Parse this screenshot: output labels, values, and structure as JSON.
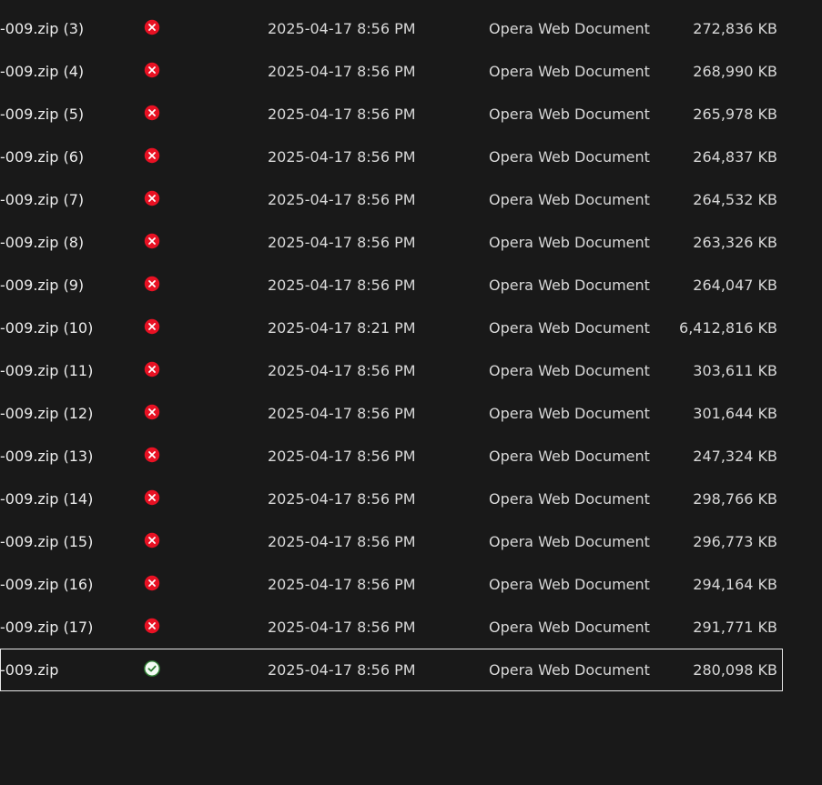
{
  "files": [
    {
      "name": "-009.zip (3)",
      "status": "error",
      "date": "2025-04-17 8:56 PM",
      "type": "Opera Web Document",
      "size": "272,836 KB"
    },
    {
      "name": "-009.zip (4)",
      "status": "error",
      "date": "2025-04-17 8:56 PM",
      "type": "Opera Web Document",
      "size": "268,990 KB"
    },
    {
      "name": "-009.zip (5)",
      "status": "error",
      "date": "2025-04-17 8:56 PM",
      "type": "Opera Web Document",
      "size": "265,978 KB"
    },
    {
      "name": "-009.zip (6)",
      "status": "error",
      "date": "2025-04-17 8:56 PM",
      "type": "Opera Web Document",
      "size": "264,837 KB"
    },
    {
      "name": "-009.zip (7)",
      "status": "error",
      "date": "2025-04-17 8:56 PM",
      "type": "Opera Web Document",
      "size": "264,532 KB"
    },
    {
      "name": "-009.zip (8)",
      "status": "error",
      "date": "2025-04-17 8:56 PM",
      "type": "Opera Web Document",
      "size": "263,326 KB"
    },
    {
      "name": "-009.zip (9)",
      "status": "error",
      "date": "2025-04-17 8:56 PM",
      "type": "Opera Web Document",
      "size": "264,047 KB"
    },
    {
      "name": "-009.zip (10)",
      "status": "error",
      "date": "2025-04-17 8:21 PM",
      "type": "Opera Web Document",
      "size": "6,412,816 KB"
    },
    {
      "name": "-009.zip (11)",
      "status": "error",
      "date": "2025-04-17 8:56 PM",
      "type": "Opera Web Document",
      "size": "303,611 KB"
    },
    {
      "name": "-009.zip (12)",
      "status": "error",
      "date": "2025-04-17 8:56 PM",
      "type": "Opera Web Document",
      "size": "301,644 KB"
    },
    {
      "name": "-009.zip (13)",
      "status": "error",
      "date": "2025-04-17 8:56 PM",
      "type": "Opera Web Document",
      "size": "247,324 KB"
    },
    {
      "name": "-009.zip (14)",
      "status": "error",
      "date": "2025-04-17 8:56 PM",
      "type": "Opera Web Document",
      "size": "298,766 KB"
    },
    {
      "name": "-009.zip (15)",
      "status": "error",
      "date": "2025-04-17 8:56 PM",
      "type": "Opera Web Document",
      "size": "296,773 KB"
    },
    {
      "name": "-009.zip (16)",
      "status": "error",
      "date": "2025-04-17 8:56 PM",
      "type": "Opera Web Document",
      "size": "294,164 KB"
    },
    {
      "name": "-009.zip (17)",
      "status": "error",
      "date": "2025-04-17 8:56 PM",
      "type": "Opera Web Document",
      "size": "291,771 KB"
    },
    {
      "name": "-009.zip",
      "status": "synced",
      "selected": true,
      "date": "2025-04-17 8:56 PM",
      "type": "Opera Web Document",
      "size": "280,098 KB"
    }
  ],
  "colors": {
    "background": "#191919",
    "error_icon": "#e81123",
    "synced_icon": "#2e7d32",
    "selection_border": "#e6e6e6"
  },
  "icons": {
    "error": "error-x-icon",
    "synced": "sync-check-icon"
  }
}
